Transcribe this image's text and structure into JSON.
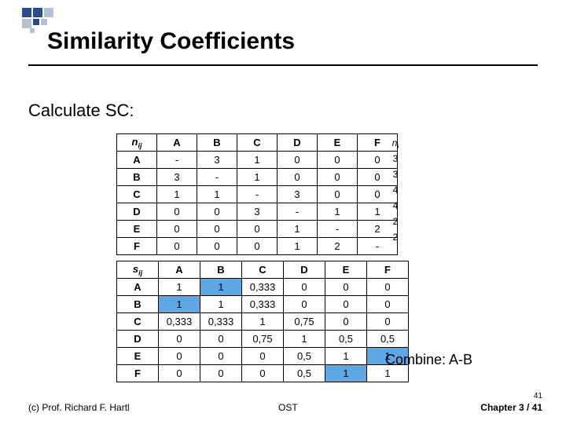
{
  "title": "Similarity Coefficients",
  "subtitle": "Calculate SC:",
  "table_n": {
    "corner": "n",
    "corner_sub": "ij",
    "cols": [
      "A",
      "B",
      "C",
      "D",
      "E",
      "F"
    ],
    "rows": [
      "A",
      "B",
      "C",
      "D",
      "E",
      "F"
    ],
    "cells": [
      [
        "-",
        "3",
        "1",
        "0",
        "0",
        "0"
      ],
      [
        "3",
        "-",
        "1",
        "0",
        "0",
        "0"
      ],
      [
        "1",
        "1",
        "-",
        "3",
        "0",
        "0"
      ],
      [
        "0",
        "0",
        "3",
        "-",
        "1",
        "1"
      ],
      [
        "0",
        "0",
        "0",
        "1",
        "-",
        "2"
      ],
      [
        "0",
        "0",
        "0",
        "1",
        "2",
        "-"
      ]
    ]
  },
  "ni": {
    "hdr": "n",
    "hdr_sub": "i",
    "vals": [
      "3",
      "3",
      "4",
      "4",
      "2",
      "2"
    ]
  },
  "table_s": {
    "corner": "s",
    "corner_sub": "ij",
    "cols": [
      "A",
      "B",
      "C",
      "D",
      "E",
      "F"
    ],
    "rows": [
      "A",
      "B",
      "C",
      "D",
      "E",
      "F"
    ],
    "cells": [
      [
        "1",
        "1",
        "0,333",
        "0",
        "0",
        "0"
      ],
      [
        "1",
        "1",
        "0,333",
        "0",
        "0",
        "0"
      ],
      [
        "0,333",
        "0,333",
        "1",
        "0,75",
        "0",
        "0"
      ],
      [
        "0",
        "0",
        "0,75",
        "1",
        "0,5",
        "0,5"
      ],
      [
        "0",
        "0",
        "0",
        "0,5",
        "1",
        "1"
      ],
      [
        "0",
        "0",
        "0",
        "0,5",
        "1",
        "1"
      ]
    ],
    "hl": [
      [
        0,
        1
      ],
      [
        1,
        0
      ],
      [
        4,
        5
      ],
      [
        5,
        4
      ]
    ]
  },
  "combine": "Combine: A-B",
  "footer": {
    "left": "(c) Prof. Richard F. Hartl",
    "mid": "OST",
    "small_page": "41",
    "chapter": "Chapter 3 / 41"
  }
}
